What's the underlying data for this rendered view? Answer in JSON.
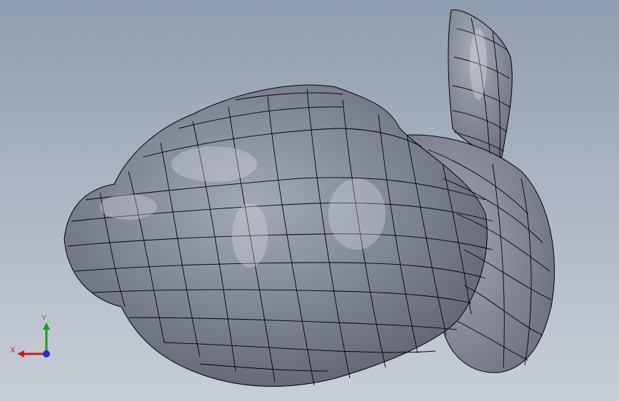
{
  "viewport": {
    "model": "bunny-surface-mesh",
    "background_top": "#8f9db0",
    "background_bottom": "#c8ced7",
    "surface_color": "#7c8190",
    "mesh_line_color": "#000000"
  },
  "triad": {
    "y_label": "Y",
    "x_label": "X",
    "y_color": "#1f9a1f",
    "x_color": "#c21f1f",
    "z_color": "#1f2fd0"
  }
}
